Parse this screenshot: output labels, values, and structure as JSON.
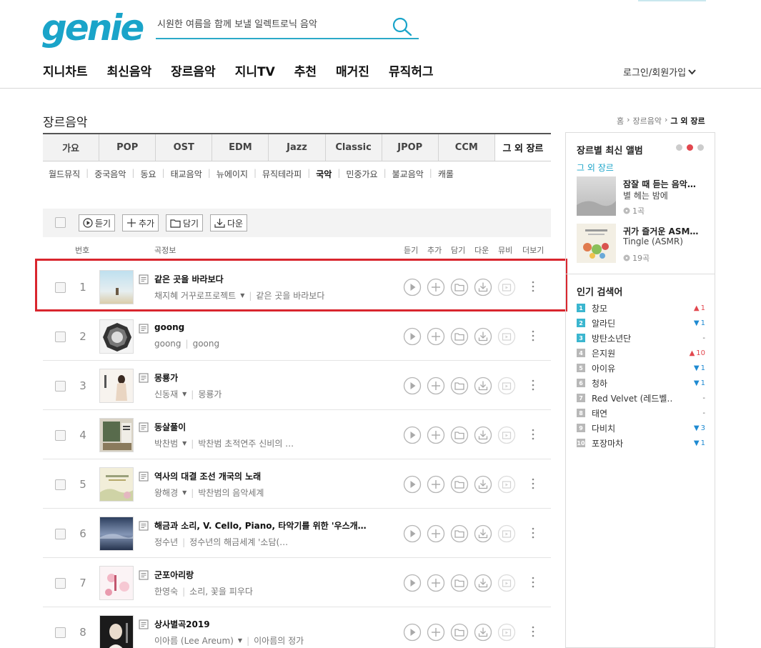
{
  "header": {
    "logo": "genie",
    "search_value": "시원한 여름을 함께 보낼 일렉트로닉 음악",
    "nav": [
      "지니차트",
      "최신음악",
      "장르음악",
      "지니TV",
      "추천",
      "매거진",
      "뮤직허그"
    ],
    "login": "로그인/회원가입"
  },
  "page": {
    "title": "장르음악",
    "breadcrumb": [
      "홈",
      "장르음악",
      "그 외 장르"
    ]
  },
  "genre_tabs": [
    "가요",
    "POP",
    "OST",
    "EDM",
    "Jazz",
    "Classic",
    "JPOP",
    "CCM",
    "그 외 장르"
  ],
  "sub_genres": [
    {
      "label": "월드뮤직",
      "active": false
    },
    {
      "label": "중국음악",
      "active": false
    },
    {
      "label": "동요",
      "active": false
    },
    {
      "label": "태교음악",
      "active": false
    },
    {
      "label": "뉴에이지",
      "active": false
    },
    {
      "label": "뮤직테라피",
      "active": false
    },
    {
      "label": "국악",
      "active": true
    },
    {
      "label": "민중가요",
      "active": false
    },
    {
      "label": "불교음악",
      "active": false
    },
    {
      "label": "캐롤",
      "active": false
    }
  ],
  "toolbar": {
    "play": "듣기",
    "add": "추가",
    "save": "담기",
    "download": "다운"
  },
  "columns": {
    "num": "번호",
    "info": "곡정보",
    "play": "듣기",
    "add": "추가",
    "save": "담기",
    "download": "다운",
    "mv": "뮤비",
    "more": "더보기"
  },
  "songs": [
    {
      "rank": "1",
      "title": "같은 곳을 바라보다",
      "artist": "채지혜 거꾸로프로젝트",
      "album": "같은 곳을 바라보다",
      "has_dropdown": true
    },
    {
      "rank": "2",
      "title": "goong",
      "artist": "goong",
      "album": "goong",
      "has_dropdown": false
    },
    {
      "rank": "3",
      "title": "몽룡가",
      "artist": "신동재",
      "album": "몽룡가",
      "has_dropdown": true
    },
    {
      "rank": "4",
      "title": "동살풀이",
      "artist": "박찬범",
      "album": "박찬범 초적연주 신비의 …",
      "has_dropdown": true
    },
    {
      "rank": "5",
      "title": "역사의 대결 조선 개국의 노래",
      "artist": "왕해경",
      "album": "박찬범의 음악세계",
      "has_dropdown": true
    },
    {
      "rank": "6",
      "title": "해금과 소리, V. Cello, Piano, 타악기를 위한 '우스개…",
      "artist": "정수년",
      "album": "정수년의 해금세계 '소담(…",
      "has_dropdown": false
    },
    {
      "rank": "7",
      "title": "군포아리랑",
      "artist": "한영숙",
      "album": "소리, 꽃을 피우다",
      "has_dropdown": false
    },
    {
      "rank": "8",
      "title": "상사별곡2019",
      "artist": "이아름 (Lee Areum)",
      "album": "이아름의 정가",
      "has_dropdown": true
    }
  ],
  "sidebar": {
    "latest_title": "장르별 최신 앨범",
    "genre_label": "그 외 장르",
    "albums": [
      {
        "title": "잠잘 때 듣는 음악…",
        "artist": "별 헤는 밤에",
        "count": "1곡"
      },
      {
        "title": "귀가 즐거운 ASM…",
        "artist": "Tingle (ASMR)",
        "count": "19곡"
      }
    ],
    "popular_title": "인기 검색어",
    "keywords": [
      {
        "rank": "1",
        "word": "창모",
        "dir": "up",
        "change": "1"
      },
      {
        "rank": "2",
        "word": "알라딘",
        "dir": "down",
        "change": "1"
      },
      {
        "rank": "3",
        "word": "방탄소년단",
        "dir": "same",
        "change": "-"
      },
      {
        "rank": "4",
        "word": "은지원",
        "dir": "up",
        "change": "10"
      },
      {
        "rank": "5",
        "word": "아이유",
        "dir": "down",
        "change": "1"
      },
      {
        "rank": "6",
        "word": "청하",
        "dir": "down",
        "change": "1"
      },
      {
        "rank": "7",
        "word": "Red Velvet (레드벨…",
        "dir": "same",
        "change": "-"
      },
      {
        "rank": "8",
        "word": "태연",
        "dir": "same",
        "change": "-"
      },
      {
        "rank": "9",
        "word": "다비치",
        "dir": "down",
        "change": "3"
      },
      {
        "rank": "10",
        "word": "포장마차",
        "dir": "down",
        "change": "1"
      }
    ]
  },
  "colors": {
    "brand": "#1aa4c9",
    "highlight": "#d9262e",
    "up": "#e2474e",
    "down": "#1f8ad1"
  }
}
